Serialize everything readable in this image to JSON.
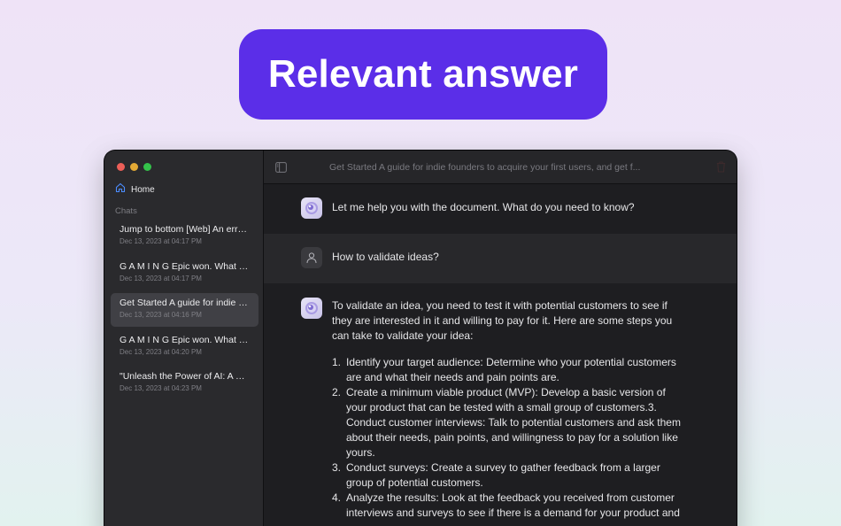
{
  "banner": {
    "title": "Relevant answer"
  },
  "sidebar": {
    "home_label": "Home",
    "chats_heading": "Chats",
    "chats": [
      {
        "title": "Jump to bottom [Web] An error occurred",
        "date": "Dec 13, 2023 at 04:17 PM",
        "active": false
      },
      {
        "title": "G A M I N G Epic won. What does it mean",
        "date": "Dec 13, 2023 at 04:17 PM",
        "active": false
      },
      {
        "title": "Get Started A guide for indie founders",
        "date": "Dec 13, 2023 at 04:16 PM",
        "active": true
      },
      {
        "title": "G A M I N G Epic won. What does it mean",
        "date": "Dec 13, 2023 at 04:20 PM",
        "active": false
      },
      {
        "title": "\"Unleash the Power of AI: A Complete",
        "date": "Dec 13, 2023 at 04:23 PM",
        "active": false
      }
    ]
  },
  "header": {
    "title": "Get Started A guide for indie founders to acquire your first users, and get f..."
  },
  "messages": {
    "greeting": "Let me help you with the document. What do you need to know?",
    "question": "How to validate ideas?",
    "answer_intro": "To validate an idea, you need to test it with potential customers to see if they are interested in it and willing to pay for it. Here are some steps you can take to validate your idea:",
    "answer_items": [
      {
        "num": "1.",
        "text": "Identify your target audience: Determine who your potential customers are and what their needs and pain points are."
      },
      {
        "num": "2.",
        "text": "Create a minimum viable product (MVP): Develop a basic version of your product that can be tested with a small group of customers.3. Conduct customer interviews: Talk to potential customers and ask them about their needs, pain points, and willingness to pay for a solution like yours."
      },
      {
        "num": "3.",
        "text": "Conduct surveys: Create a survey to gather feedback from a larger group of potential customers."
      },
      {
        "num": "4.",
        "text": "Analyze the results: Look at the feedback you received from customer interviews and surveys to see if there is a demand for your product and"
      }
    ]
  },
  "colors": {
    "banner": "#5b2ee8",
    "traffic_red": "#ec5f58",
    "traffic_yellow": "#e3a935",
    "traffic_green": "#34c24a",
    "home_icon": "#4c8dff"
  },
  "icons": {
    "home": "house-icon",
    "sidebar_toggle": "sidebar-toggle-icon",
    "trash": "trash-icon",
    "bot": "ai-orb-icon",
    "user": "person-icon"
  }
}
